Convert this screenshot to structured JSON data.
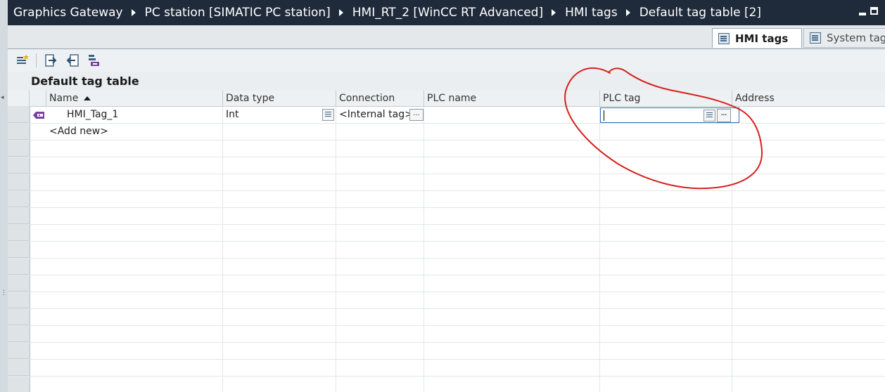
{
  "breadcrumb": [
    "Graphics Gateway",
    "PC station [SIMATIC PC station]",
    "HMI_RT_2 [WinCC RT Advanced]",
    "HMI tags",
    "Default tag table [2]"
  ],
  "tabs": {
    "active": "HMI tags",
    "inactive": "System tag"
  },
  "section": {
    "title": "Default tag table"
  },
  "columns": {
    "name": "Name",
    "data_type": "Data type",
    "connection": "Connection",
    "plc_name": "PLC name",
    "plc_tag": "PLC tag",
    "address": "Address"
  },
  "rows": [
    {
      "name": "HMI_Tag_1",
      "data_type": "Int",
      "connection": "<Internal tag>",
      "plc_name": "",
      "plc_tag": ""
    }
  ],
  "add_new": "<Add new>",
  "icons": {
    "toolbar": [
      "add-tag-icon",
      "export-icon",
      "import-icon",
      "tag-properties-icon"
    ],
    "row": "hmi-tag-icon",
    "picker": "list-icon",
    "browse": "ellipsis-icon"
  },
  "colors": {
    "titlebar": "#1f2a3a",
    "annotation": "#d6201c",
    "selection": "#2e6bbf"
  }
}
